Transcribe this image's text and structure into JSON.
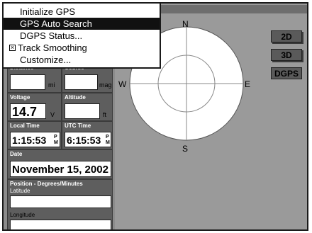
{
  "menu": {
    "items": [
      {
        "label": "Initialize GPS",
        "selected": false
      },
      {
        "label": "GPS Auto Search",
        "selected": true
      },
      {
        "label": "DGPS Status...",
        "selected": false
      },
      {
        "label": "Track Smoothing",
        "selected": false,
        "checked": true
      },
      {
        "label": "Customize...",
        "selected": false
      }
    ]
  },
  "panel": {
    "distance_label": "Distance",
    "distance_unit": "mi",
    "course_label": "Course",
    "course_unit": "mag",
    "voltage_label": "Voltage",
    "voltage_value": "14.7",
    "voltage_unit": "V",
    "altitude_label": "Altitude",
    "altitude_unit": "ft",
    "local_time_label": "Local Time",
    "local_time_value": "1:15:53",
    "utc_time_label": "UTC Time",
    "utc_time_value": "6:15:53",
    "pm_top": "P",
    "pm_bottom": "M",
    "date_label": "Date",
    "date_value": "November 15, 2002",
    "position_label": "Position - Degrees/Minutes",
    "latitude_label": "Latitude",
    "longitude_label": "Longitude"
  },
  "sky": {
    "north": "N",
    "south": "S",
    "east": "E",
    "west": "W"
  },
  "modes": {
    "two_d": "2D",
    "three_d": "3D",
    "dgps": "DGPS"
  },
  "colors": {
    "screen": "#9a9a9a",
    "panel": "#8c8c8c",
    "label_bg": "#5e5e5e",
    "menu_selected": "#111111"
  }
}
